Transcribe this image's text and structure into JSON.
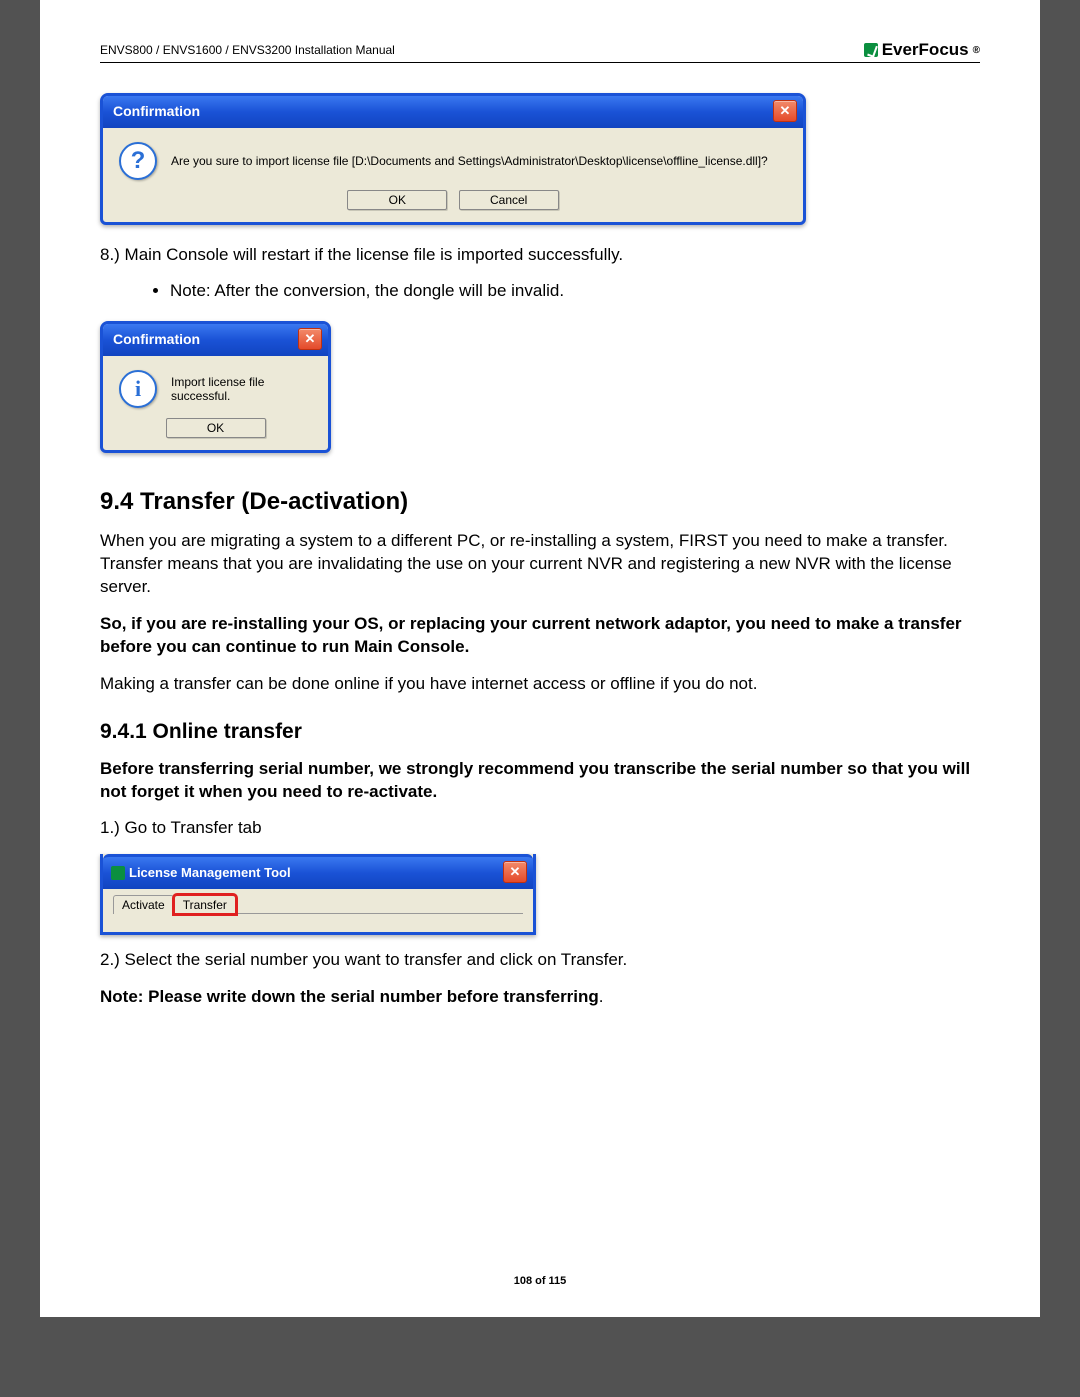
{
  "header": {
    "left": "ENVS800 / ENVS1600 / ENVS3200 Installation Manual",
    "brand": "EverFocus"
  },
  "dlg1": {
    "title": "Confirmation",
    "msg": "Are you sure to import license file [D:\\Documents and Settings\\Administrator\\Desktop\\license\\offline_license.dll]?",
    "ok": "OK",
    "cancel": "Cancel"
  },
  "step8": "8.) Main Console will restart if the license file is imported successfully.",
  "note1": "Note: After the conversion, the dongle will be invalid.",
  "dlg2": {
    "title": "Confirmation",
    "msg": "Import license file successful.",
    "ok": "OK"
  },
  "sec94": {
    "heading": "9.4   Transfer (De-activation)",
    "p1": "When you are migrating a system to a different PC, or re-installing a system, FIRST you need to make a transfer. Transfer means that you are invalidating the use on your current NVR and registering a new NVR with the license server.",
    "p2": "So, if you are re-installing your OS, or replacing your current network adaptor, you need to make a transfer before you can continue to run Main Console.",
    "p3": "Making a transfer can be done online if you have internet access or offline if you do not."
  },
  "sec941": {
    "heading": "9.4.1 Online transfer",
    "p1": "Before transferring serial number, we strongly recommend you transcribe the serial number so that you will not forget it when you need to re-activate.",
    "step1": "1.) Go to Transfer tab",
    "step2": "2.) Select the serial number you want to transfer and click on Transfer.",
    "note": "Note: Please write down the serial number before transferring",
    "note_suffix": "."
  },
  "lmt": {
    "title": "License Management Tool",
    "tab_activate": "Activate",
    "tab_transfer": "Transfer"
  },
  "footer": "108 of 115"
}
